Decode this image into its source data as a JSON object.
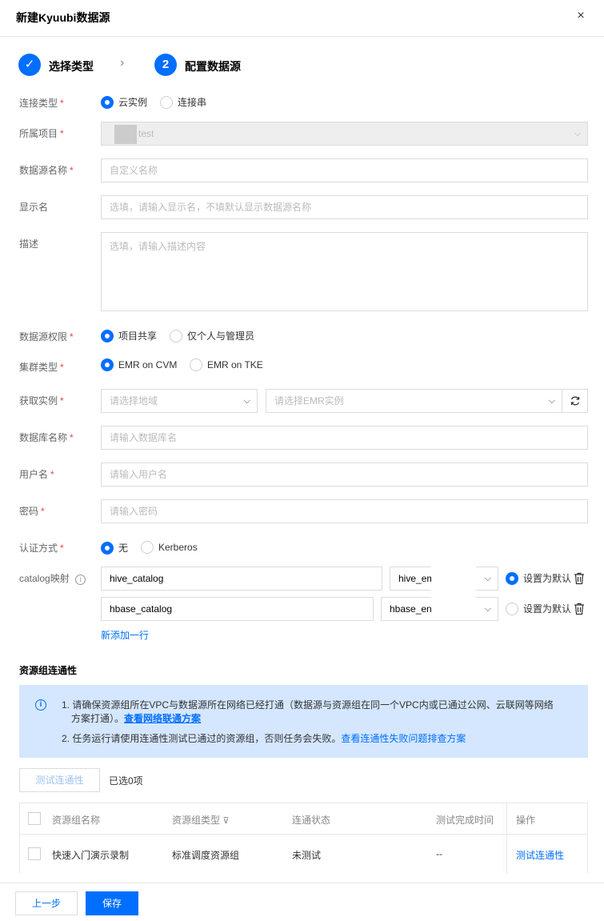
{
  "dialog": {
    "title": "新建Kyuubi数据源",
    "close_icon": "×"
  },
  "steps": [
    {
      "label": "选择类型",
      "state": "done",
      "mark": "✓"
    },
    {
      "label": "配置数据源",
      "state": "active",
      "mark": "2"
    }
  ],
  "form": {
    "conn_type": {
      "label": "连接类型",
      "options": [
        "云实例",
        "连接串"
      ],
      "selected": 0
    },
    "project": {
      "label": "所属项目",
      "value": "test"
    },
    "ds_name": {
      "label": "数据源名称",
      "placeholder": "自定义名称"
    },
    "display_name": {
      "label": "显示名",
      "placeholder": "选填，请输入显示名，不填默认显示数据源名称"
    },
    "desc": {
      "label": "描述",
      "placeholder": "选填，请输入描述内容"
    },
    "permission": {
      "label": "数据源权限",
      "options": [
        "项目共享",
        "仅个人与管理员"
      ],
      "selected": 0
    },
    "cluster_type": {
      "label": "集群类型",
      "options": [
        "EMR on CVM",
        "EMR on TKE"
      ],
      "selected": 0
    },
    "instance": {
      "label": "获取实例",
      "region_placeholder": "请选择地域",
      "emr_placeholder": "请选择EMR实例"
    },
    "db_name": {
      "label": "数据库名称",
      "placeholder": "请输入数据库名"
    },
    "username": {
      "label": "用户名",
      "placeholder": "请输入用户名"
    },
    "password": {
      "label": "密码",
      "placeholder": "请输入密码"
    },
    "auth": {
      "label": "认证方式",
      "options": [
        "无",
        "Kerberos"
      ],
      "selected": 0
    },
    "catalog": {
      "label": "catalog映射",
      "rows": [
        {
          "name": "hive_catalog",
          "select": "hive_em",
          "default_label": "设置为默认",
          "is_default": true
        },
        {
          "name": "hbase_catalog",
          "select": "hbase_en",
          "default_label": "设置为默认",
          "is_default": false
        }
      ],
      "add_label": "新添加一行"
    }
  },
  "resource": {
    "title": "资源组连通性",
    "notice": {
      "line1": "1. 请确保资源组所在VPC与数据源所在网络已经打通（数据源与资源组在同一个VPC内或已通过公网、云联网等网络",
      "line1b": "方案打通）。",
      "line1_link": "查看网络联通方案",
      "line2": "2. 任务运行请使用连通性测试已通过的资源组，否则任务会失败。",
      "line2_link": "查看连通性失败问题排查方案"
    },
    "test_button": "测试连通性",
    "selected_text": "已选0项",
    "table": {
      "headers": [
        "资源组名称",
        "资源组类型",
        "连通状态",
        "测试完成时间",
        "操作"
      ],
      "rows": [
        {
          "name": "快速入门演示录制",
          "type": "标准调度资源组",
          "status": "未测试",
          "time": "--",
          "action": "测试连通性"
        }
      ]
    }
  },
  "footer": {
    "prev": "上一步",
    "save": "保存"
  },
  "colors": {
    "primary": "#006eff",
    "required": "#e54545",
    "notice_bg": "#d5e7ff"
  }
}
